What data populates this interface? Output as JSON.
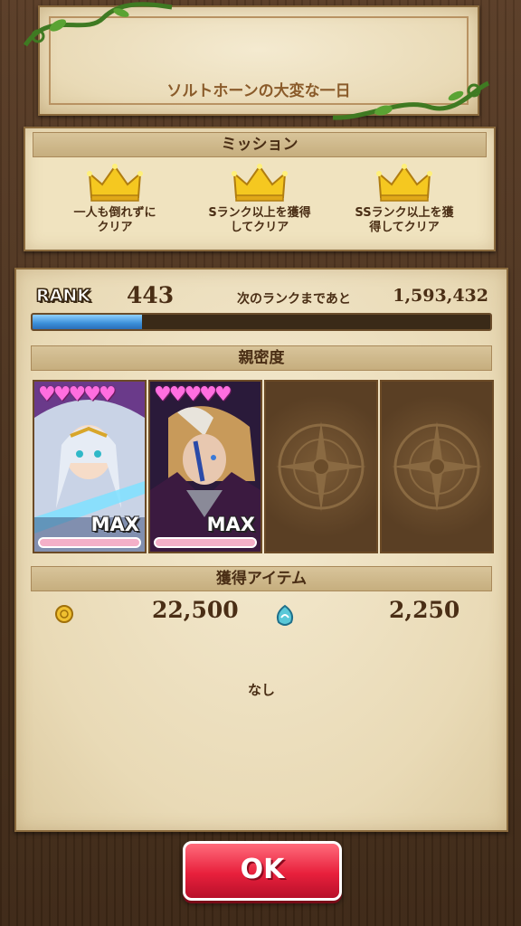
{
  "title": "ソルトホーンの大変な一日",
  "mission": {
    "header": "ミッション",
    "items": [
      {
        "label": "一人も倒れずに\nクリア",
        "icon": "crown-icon"
      },
      {
        "label": "Sランク以上を獲得\nしてクリア",
        "icon": "crown-icon"
      },
      {
        "label": "SSランク以上を獲\n得してクリア",
        "icon": "crown-icon"
      }
    ]
  },
  "rank": {
    "badge": "RANK",
    "value": "443",
    "next_label": "次のランクまであと",
    "next_value": "1,593,432",
    "progress": 0.24
  },
  "intimacy": {
    "header": "親密度",
    "cards": [
      {
        "filled": true,
        "hearts": "♥♥♥♥♥",
        "max": "MAX",
        "portrait": "silver-haired-heroine"
      },
      {
        "filled": true,
        "hearts": "♥♥♥♥♥",
        "max": "MAX",
        "portrait": "masked-dark-hero"
      },
      {
        "filled": false
      },
      {
        "filled": false
      }
    ]
  },
  "items": {
    "header": "獲得アイテム",
    "gold": {
      "icon": "gold-coin-icon",
      "value": "22,500"
    },
    "crystal": {
      "icon": "mana-crystal-icon",
      "value": "2,250"
    },
    "none_label": "なし"
  },
  "ok_label": "OK",
  "colors": {
    "parchment": "#efe3c3",
    "wood": "#4a3220",
    "text_brown": "#4a2e15",
    "exp_blue": "#3b8fd8",
    "ok_red": "#e8203c",
    "heart_pink": "#ff6ee0"
  }
}
